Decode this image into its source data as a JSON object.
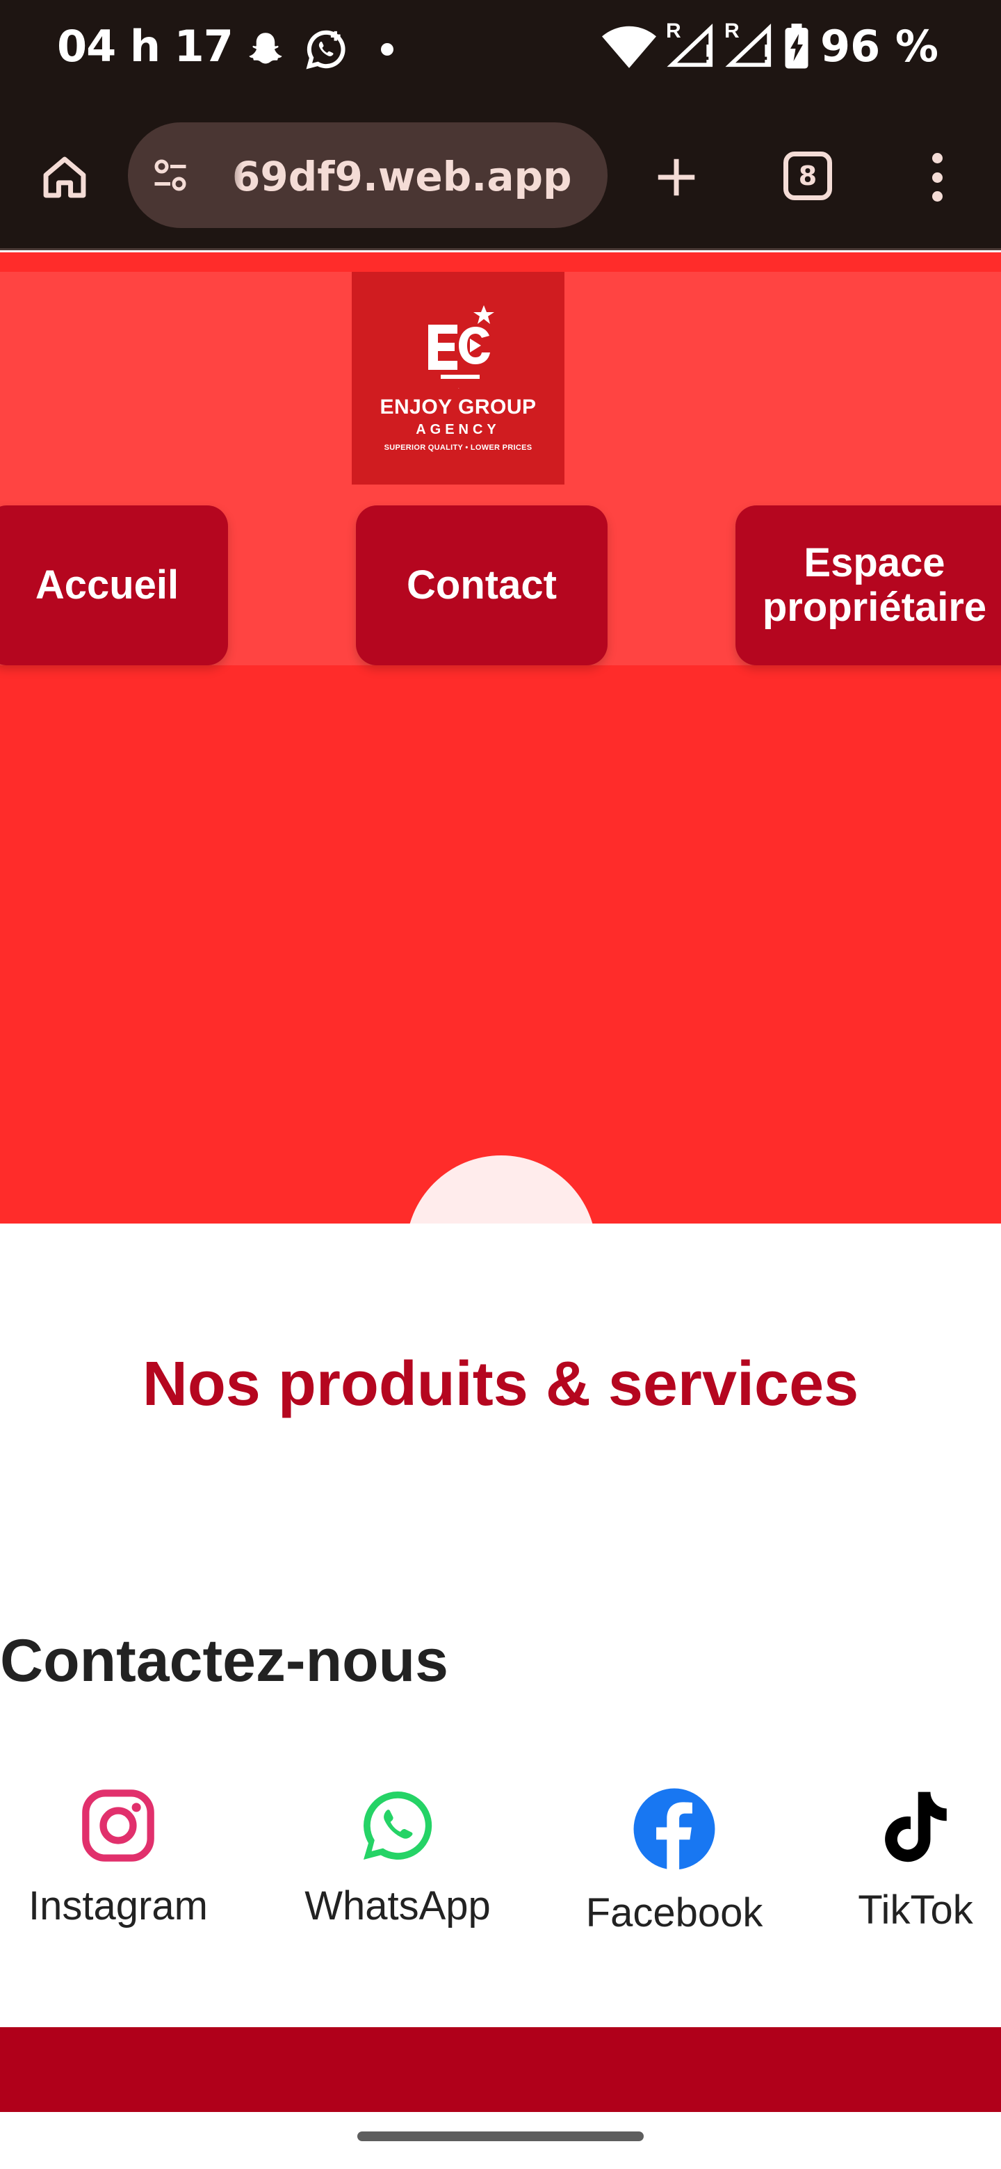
{
  "status_bar": {
    "time": "04 h 17",
    "battery": "96 %",
    "left_icons": [
      "snapchat-icon",
      "whatsapp-status-icon",
      "notification-dot"
    ],
    "right_icons": [
      "wifi-icon",
      "signal-roaming-icon",
      "signal-roaming-icon",
      "battery-charging-icon"
    ],
    "roaming_letter": "R"
  },
  "browser": {
    "url": "69df9.web.app",
    "tab_count": "8",
    "icons": [
      "home-icon",
      "tune-icon",
      "plus-icon",
      "tabs-icon",
      "more-vert-icon"
    ]
  },
  "header": {
    "logo": {
      "monogram": "EG",
      "name": "ENJOY GROUP",
      "sub": "AGENCY",
      "tagline": "SUPERIOR QUALITY • LOWER PRICES"
    },
    "nav": [
      "Accueil",
      "Contact",
      "Espace propriétaire"
    ]
  },
  "main": {
    "section_title": "Nos produits & services",
    "contact_title": "Contactez-nous",
    "socials": [
      {
        "label": "Instagram",
        "icon": "instagram-icon",
        "color": "#e1306c"
      },
      {
        "label": "WhatsApp",
        "icon": "whatsapp-icon",
        "color": "#25d366"
      },
      {
        "label": "Facebook",
        "icon": "facebook-icon",
        "color": "#1877f2"
      },
      {
        "label": "TikTok",
        "icon": "tiktok-icon",
        "color": "#000000"
      }
    ]
  },
  "colors": {
    "status_bg": "#1e1512",
    "hero_red": "#ff2c2a",
    "header_red": "#ff4442",
    "nav_button": "#b5061f",
    "title_red": "#b5061f",
    "footer_red": "#b0001a"
  }
}
